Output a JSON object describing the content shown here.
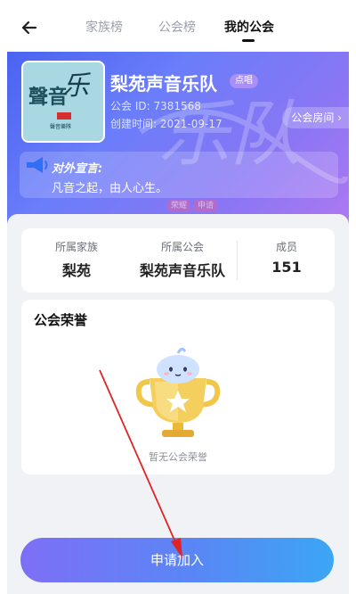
{
  "nav": {
    "tabs": [
      {
        "label": "家族榜"
      },
      {
        "label": "公会榜"
      },
      {
        "label": "我的公会"
      }
    ],
    "active_tab": "我的公会"
  },
  "guild": {
    "name": "梨苑声音乐队",
    "badge": "点唱",
    "id_text": "公会 ID: 7381568",
    "created_text": "创建时间: 2021-09-17",
    "room_button": "公会房间",
    "cover_text": {
      "big_chars": "聲音",
      "script_char": "乐",
      "small_text": "聲音樂隊"
    },
    "watermark": {
      "chars": "乐队",
      "tags": [
        "荣耀",
        "申请"
      ]
    }
  },
  "announcement": {
    "title": "对外宣言:",
    "text": "凡音之起，由人心生。"
  },
  "stats": [
    {
      "label": "所属家族",
      "value": "梨苑"
    },
    {
      "label": "所属公会",
      "value": "梨苑声音乐队"
    },
    {
      "label": "成员",
      "value": "151"
    }
  ],
  "honor": {
    "title": "公会荣誉",
    "empty_text": "暂无公会荣誉"
  },
  "apply_button": "申请加入",
  "colors": {
    "banner_gradient": [
      "#4a63f0",
      "#b178f1"
    ],
    "button_gradient": [
      "#7d6ff6",
      "#3ba6f4"
    ],
    "annotation_arrow": "#e02424"
  },
  "icons": [
    "back-arrow-icon",
    "chevron-right-icon",
    "megaphone-icon",
    "trophy-icon"
  ]
}
